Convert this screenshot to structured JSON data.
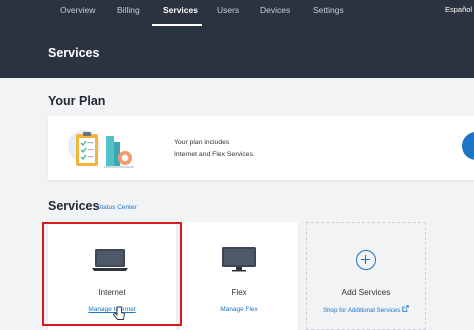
{
  "nav": {
    "items": [
      "Overview",
      "Billing",
      "Services",
      "Users",
      "Devices",
      "Settings"
    ],
    "active": "Services",
    "language": "Español"
  },
  "header": {
    "title": "Services"
  },
  "plan": {
    "title": "Your Plan",
    "text_line1": "Your plan includes",
    "text_line2": "Internet and Flex Services."
  },
  "services": {
    "title": "Services",
    "status_link": "Status Center",
    "cards": [
      {
        "name": "Internet",
        "link": "Manage Internet",
        "icon": "laptop-icon"
      },
      {
        "name": "Flex",
        "link": "Manage Flex",
        "icon": "tv-icon"
      },
      {
        "name": "Add Services",
        "link": "Shop for Additional Services",
        "icon": "plus-circle-icon"
      }
    ]
  },
  "colors": {
    "nav_bg": "#2c3340",
    "link_blue": "#1c74c6",
    "highlight_red": "#d71920"
  }
}
